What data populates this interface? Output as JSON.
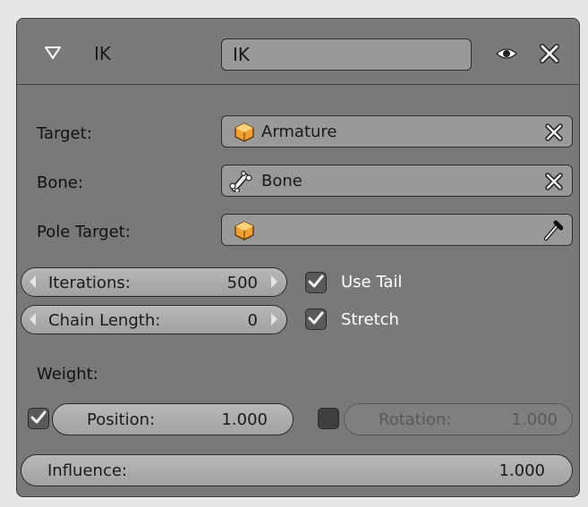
{
  "header": {
    "title": "IK",
    "name_value": "IK",
    "icons": {
      "collapse": "triangle-down-icon",
      "visibility": "eye-icon",
      "delete": "x-icon"
    }
  },
  "fields": {
    "target": {
      "label": "Target:",
      "value": "Armature",
      "icon": "object-cube-icon"
    },
    "bone": {
      "label": "Bone:",
      "value": "Bone",
      "icon": "bone-icon"
    },
    "pole_target": {
      "label": "Pole Target:",
      "value": "",
      "icon": "object-cube-icon"
    }
  },
  "iterations": {
    "label": "Iterations:",
    "value": "500"
  },
  "chain_length": {
    "label": "Chain Length:",
    "value": "0"
  },
  "use_tail": {
    "label": "Use Tail",
    "checked": true
  },
  "stretch": {
    "label": "Stretch",
    "checked": true
  },
  "weight": {
    "label": "Weight:",
    "position": {
      "label": "Position:",
      "value": "1.000",
      "enabled": true
    },
    "rotation": {
      "label": "Rotation:",
      "value": "1.000",
      "enabled": false
    }
  },
  "influence": {
    "label": "Influence:",
    "value": "1.000"
  },
  "colors": {
    "panel": "#797979",
    "field": "#999999",
    "slider": "#b0b0b0",
    "object_icon": "#f0a030"
  }
}
